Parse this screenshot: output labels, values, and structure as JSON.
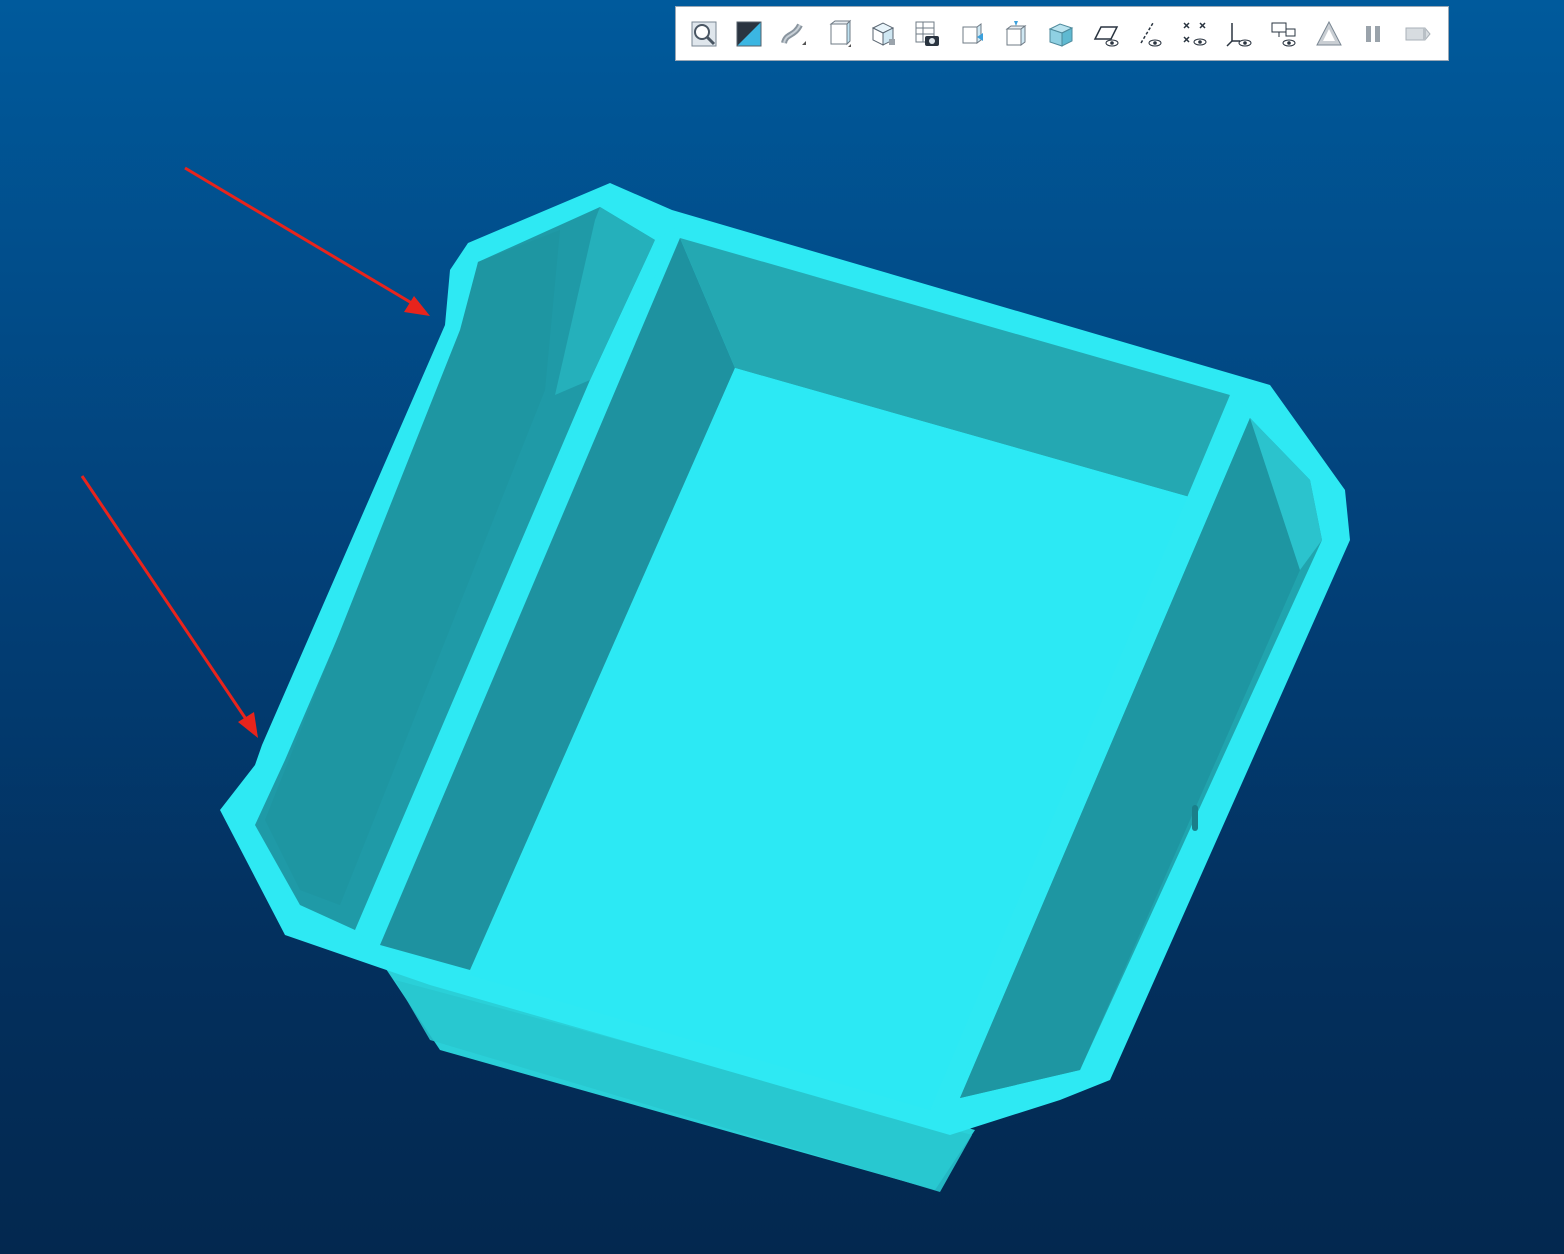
{
  "app": {
    "title": "",
    "viewport": {
      "background_top": "#005a9c",
      "background_bottom": "#03284f",
      "model_color": "#2de8f2",
      "annotation_color": "#e8241c"
    }
  },
  "toolbar": {
    "items": [
      {
        "name": "zoom-fit-icon"
      },
      {
        "name": "shading-toggle-icon"
      },
      {
        "name": "surface-render-icon"
      },
      {
        "name": "view-cube-front-icon"
      },
      {
        "name": "view-cube-lock-icon"
      },
      {
        "name": "screenshot-table-icon"
      },
      {
        "name": "view-left-icon"
      },
      {
        "name": "view-top-icon"
      },
      {
        "name": "iso-view-icon"
      },
      {
        "name": "plane-visibility-icon"
      },
      {
        "name": "axis-visibility-icon"
      },
      {
        "name": "points-visibility-icon"
      },
      {
        "name": "csys-visibility-icon"
      },
      {
        "name": "annotation-visibility-icon"
      },
      {
        "name": "appearance-icon"
      },
      {
        "name": "pause-icon"
      },
      {
        "name": "exit-icon"
      }
    ]
  },
  "annotations": {
    "arrows": [
      {
        "name": "upper-arrow"
      },
      {
        "name": "lower-arrow"
      }
    ]
  }
}
